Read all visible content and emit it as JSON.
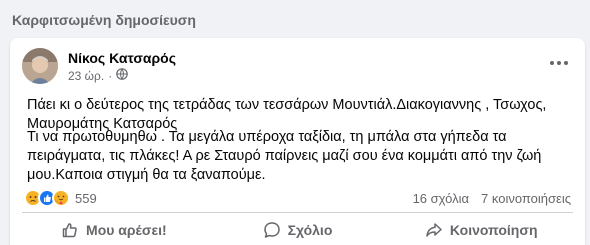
{
  "pinned_label": "Καρφιτσωμένη δημοσίευση",
  "post": {
    "author": "Νίκος Κατσαρός",
    "time": "23 ώρ.",
    "dot": "·",
    "paragraph1": "Πάει κι ο δεύτερος της τετράδας των τεσσάρων Μουντιάλ.Διακογιαννης , Τσωχος, Μαυρομάτης Κατσαρός",
    "paragraph2": " Τι να πρωτοθυμηθω . Τα μεγάλα υπέροχα ταξίδια, τη μπάλα στα γήπεδα τα πειράγματα, τις πλάκες! Α ρε Σταυρό παίρνεις μαζί σου ένα κομμάτι από την ζωή  μου.Καποια στιγμή  θα τα ξαναπούμε.",
    "reaction_count": "559",
    "comments": "16 σχόλια",
    "shares": "7 κοινοποιήσεις",
    "reactions": [
      "sad",
      "like",
      "care"
    ]
  },
  "actions": {
    "like": "Μου αρέσει!",
    "comment": "Σχόλιο",
    "share": "Κοινοποίηση"
  },
  "colors": {
    "background": "#f0f2f5",
    "secondary_text": "#65676b",
    "like_blue": "#1877f2",
    "reaction_yellow": "#f7b125"
  }
}
